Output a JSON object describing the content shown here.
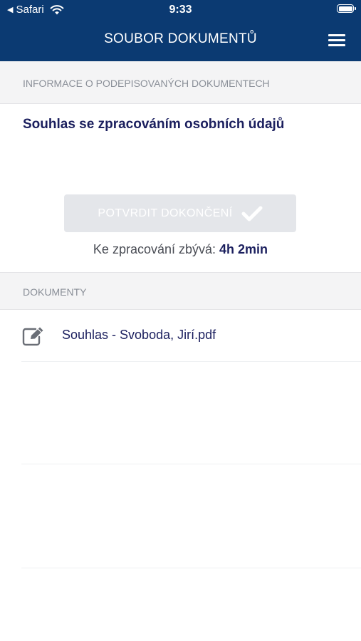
{
  "status_bar": {
    "back_app": "Safari",
    "time": "9:33"
  },
  "header": {
    "title": "SOUBOR DOKUMENTŮ"
  },
  "info_section": {
    "header": "INFORMACE O PODEPISOVANÝCH DOKUMENTECH",
    "document_set_title": "Souhlas se zpracováním osobních údajů",
    "confirm_button_label": "POTVRDIT DOKONČENÍ",
    "remaining_label": "Ke zpracování zbývá:",
    "remaining_value": "4h 2min"
  },
  "documents_section": {
    "header": "DOKUMENTY",
    "items": [
      {
        "name": "Souhlas - Svoboda, Jirí.pdf",
        "icon": "edit-document-icon"
      }
    ]
  },
  "colors": {
    "header_bg": "#0b3a72",
    "title_text": "#1b1f5e",
    "section_header_bg": "#f4f4f5",
    "disabled_button_bg": "#e4e6ea"
  }
}
